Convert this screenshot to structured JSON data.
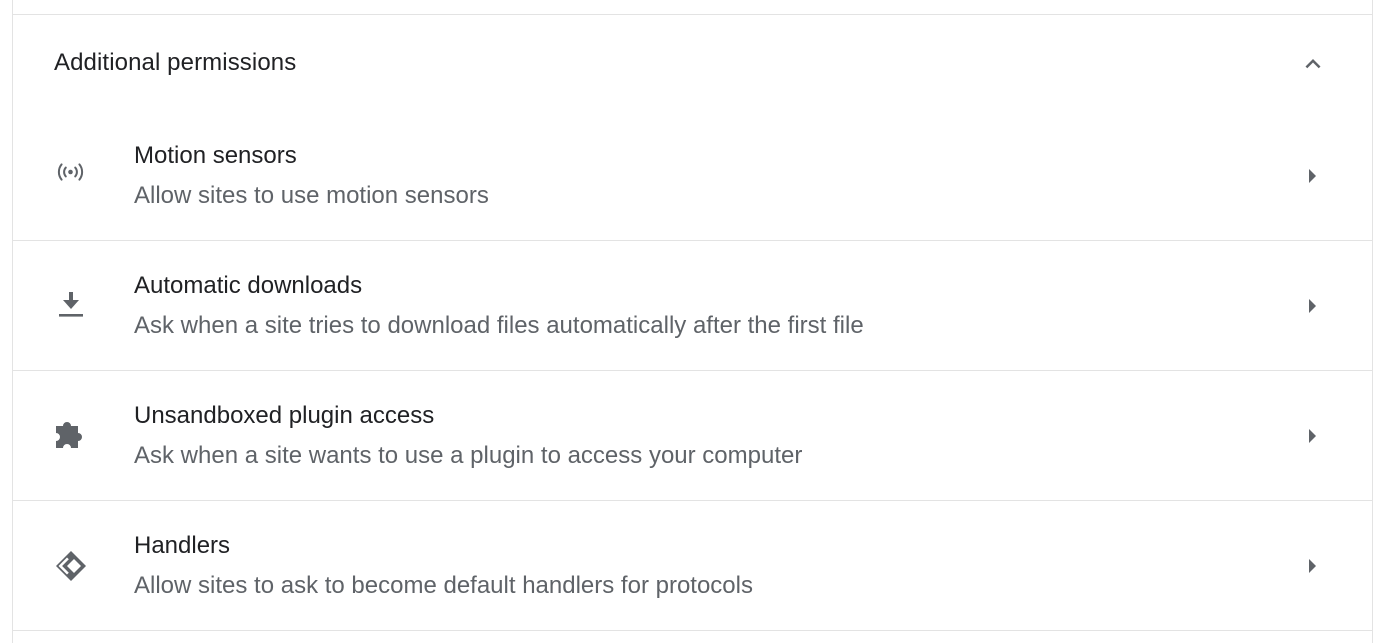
{
  "section": {
    "title": "Additional permissions",
    "expanded_icon": "chevron-up-icon"
  },
  "colors": {
    "title_text": "#202124",
    "secondary_text": "#5f6368",
    "icon": "#5f6368",
    "divider": "#e3e3e3"
  },
  "items": [
    {
      "title": "Motion sensors",
      "description": "Allow sites to use motion sensors",
      "icon": "sensors-icon"
    },
    {
      "title": "Automatic downloads",
      "description": "Ask when a site tries to download files automatically after the first file",
      "icon": "download-icon"
    },
    {
      "title": "Unsandboxed plugin access",
      "description": "Ask when a site wants to use a plugin to access your computer",
      "icon": "puzzle-icon"
    },
    {
      "title": "Handlers",
      "description": "Allow sites to ask to become default handlers for protocols",
      "icon": "handlers-icon"
    }
  ]
}
